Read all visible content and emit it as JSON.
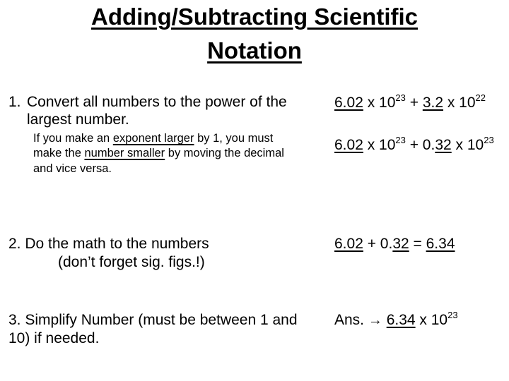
{
  "title": {
    "line1": "Adding/Subtracting Scientific",
    "line2": "Notation"
  },
  "steps": [
    {
      "number": "1.",
      "text_line1": "Convert all numbers to the power of the",
      "text_line2": "largest number.",
      "note": {
        "part1": "If you make an ",
        "underline1": "exponent larger",
        "part2": " by 1, you must",
        "part3": "make the ",
        "underline2": "number smaller",
        "part4": " by moving the decimal",
        "part5": "and vice versa."
      }
    },
    {
      "text_line1": "2. Do the math to the numbers",
      "text_line2": "(don’t forget sig. figs.!)"
    },
    {
      "text_line1": "3. Simplify Number (must be between 1 and",
      "text_line2": "10) if needed."
    }
  ],
  "examples": {
    "original": {
      "a_coef": "6.02",
      "times1": " x 10",
      "a_exp": "23",
      "plus": " + ",
      "b_coef": "3.2",
      "times2": " x 10",
      "b_exp": "22"
    },
    "converted": {
      "a_coef": "6.02",
      "times1": " x 10",
      "a_exp": "23",
      "plus": " + 0.",
      "b_coef_underlined": "32",
      "times2": " x 10",
      "b_exp": "23"
    },
    "math": {
      "a": "6.02",
      "plus": " + 0.",
      "b_underlined": "32",
      "equals": " = ",
      "result": "6.34"
    },
    "answer": {
      "label": "Ans. ",
      "arrow": "→",
      "coef": "6.34",
      "times": " x 10",
      "exp": "23"
    }
  }
}
